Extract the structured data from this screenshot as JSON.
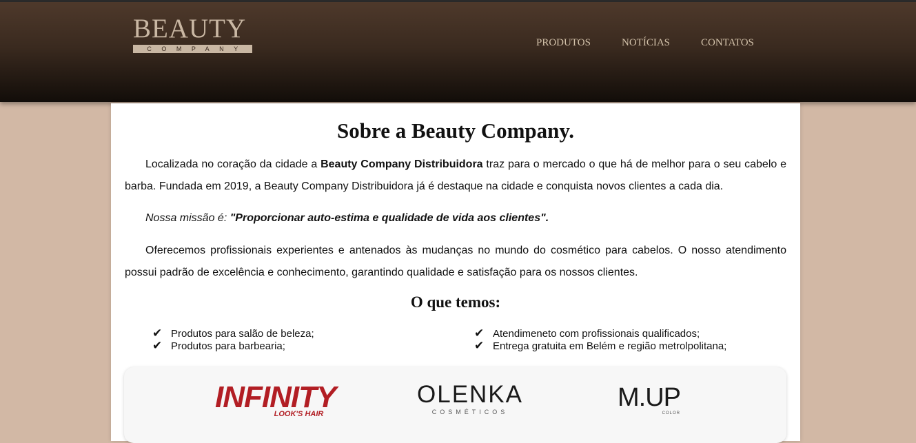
{
  "header": {
    "logo": {
      "word": "BEAUTY",
      "sub": "COMPANY"
    },
    "nav": [
      {
        "label": "PRODUTOS"
      },
      {
        "label": "NOTÍCIAS"
      },
      {
        "label": "CONTATOS"
      }
    ]
  },
  "main": {
    "title": "Sobre a Beauty Company.",
    "p1_pre": "Localizada no coração da cidade a ",
    "p1_bold": "Beauty Company Distribuidora",
    "p1_post": " traz para o mercado o que há de melhor para o seu cabelo e barba. Fundada em 2019, a Beauty Company Distribuidora já é destaque na cidade e conquista novos clientes a cada dia.",
    "mission_label": "Nossa missão é: ",
    "mission_text": "\"Proporcionar auto-estima e qualidade de vida aos clientes\".",
    "p3": "Oferecemos profissionais experientes e antenados às mudanças no mundo do cosmético para cabelos. O nosso atendimento possui padrão de excelência e conhecimento, garantindo qualidade e satisfação para os nossos clientes.",
    "subtitle": "O que temos:",
    "check_icon": "✔",
    "features": [
      "Produtos para salão de beleza;",
      "Produtos para barbearia;",
      "Atendimeneto com profissionais qualificados;",
      "Entrega gratuita em Belém e região metrolpolitana;"
    ]
  },
  "brands": [
    {
      "name": "INFINITY",
      "sub": "LOOK'S HAIR",
      "color": "#b21e24"
    },
    {
      "name": "OLENKA",
      "sub": "COSMÉTICOS",
      "color": "#1a1a1a"
    },
    {
      "name": "M.UP",
      "sub": "COLOR",
      "color": "#1a1a1a"
    }
  ]
}
